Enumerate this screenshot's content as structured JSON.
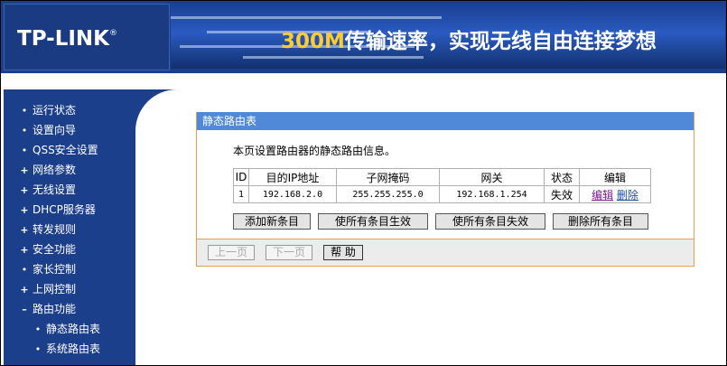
{
  "header": {
    "logo": "TP-LINK",
    "logo_mark": "®",
    "slogan_highlight": "300M",
    "slogan_text": "传输速率，实现无线自由连接梦想"
  },
  "sidebar": {
    "items": [
      {
        "label": "运行状态",
        "marker": "dot"
      },
      {
        "label": "设置向导",
        "marker": "dot"
      },
      {
        "label": "QSS安全设置",
        "marker": "dot"
      },
      {
        "label": "网络参数",
        "marker": "plus"
      },
      {
        "label": "无线设置",
        "marker": "plus"
      },
      {
        "label": "DHCP服务器",
        "marker": "plus"
      },
      {
        "label": "转发规则",
        "marker": "plus"
      },
      {
        "label": "安全功能",
        "marker": "plus"
      },
      {
        "label": "家长控制",
        "marker": "dot"
      },
      {
        "label": "上网控制",
        "marker": "plus"
      },
      {
        "label": "路由功能",
        "marker": "minus"
      },
      {
        "label": "静态路由表",
        "marker": "dot",
        "sub": true
      },
      {
        "label": "系统路由表",
        "marker": "dot",
        "sub": true
      }
    ]
  },
  "panel": {
    "title": "静态路由表",
    "description": "本页设置路由器的静态路由信息。",
    "columns": [
      "ID",
      "目的IP地址",
      "子网掩码",
      "网关",
      "状态",
      "编辑"
    ],
    "rows": [
      {
        "id": "1",
        "dest": "192.168.2.0",
        "mask": "255.255.255.0",
        "gateway": "192.168.1.254",
        "status": "失效",
        "edit": "编辑",
        "delete": "删除"
      }
    ],
    "buttons": {
      "add": "添加新条目",
      "enable_all": "使所有条目生效",
      "disable_all": "使所有条目失效",
      "delete_all": "删除所有条目"
    },
    "pager": {
      "prev": "上一页",
      "next": "下一页",
      "help": "帮 助"
    }
  },
  "colors": {
    "nav_bg": "#1c3f8c",
    "panel_title": "#4f89d8",
    "panel_border": "#e0a050",
    "slogan_accent": "#ffcc33"
  }
}
